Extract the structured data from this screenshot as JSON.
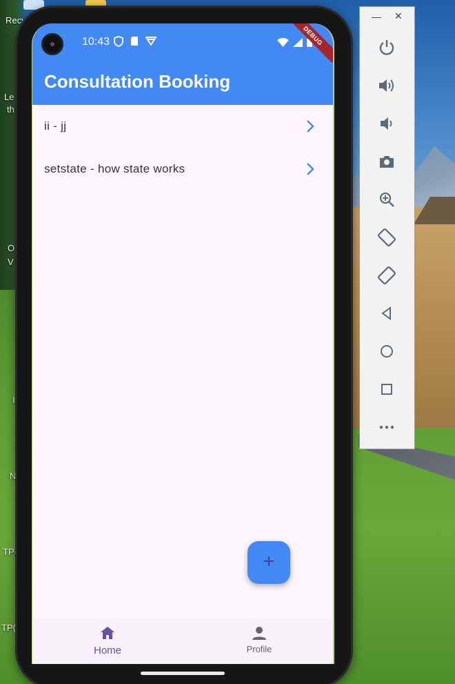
{
  "desktop": {
    "icons": [
      {
        "label": "Recy"
      },
      {
        "label": "Le"
      },
      {
        "label": "th"
      },
      {
        "label": "O"
      },
      {
        "label": "V"
      },
      {
        "label": "I"
      },
      {
        "label": "N"
      },
      {
        "label": "TP("
      },
      {
        "label": "TP("
      }
    ]
  },
  "status_bar": {
    "time": "10:43",
    "debug_label": "DEBUG"
  },
  "app_bar": {
    "title": "Consultation Booking"
  },
  "list": {
    "items": [
      {
        "label": "ii - jj"
      },
      {
        "label": "setstate - how state works"
      }
    ]
  },
  "fab": {
    "icon": "plus-icon"
  },
  "bottom_nav": {
    "items": [
      {
        "label": "Home",
        "icon": "home-icon",
        "selected": true
      },
      {
        "label": "Profile",
        "icon": "person-icon",
        "selected": false
      }
    ]
  },
  "colors": {
    "primary": "#4389f5",
    "background": "#fcf6fc",
    "nav_selected": "#6a4fa3",
    "debug_banner": "#a4262c"
  },
  "emulator_toolbar": {
    "buttons": [
      "power-icon",
      "volume-up-icon",
      "volume-down-icon",
      "camera-icon",
      "zoom-icon",
      "rotate-left-icon",
      "rotate-right-icon",
      "back-icon",
      "home-circle-icon",
      "overview-icon",
      "more-icon"
    ]
  }
}
